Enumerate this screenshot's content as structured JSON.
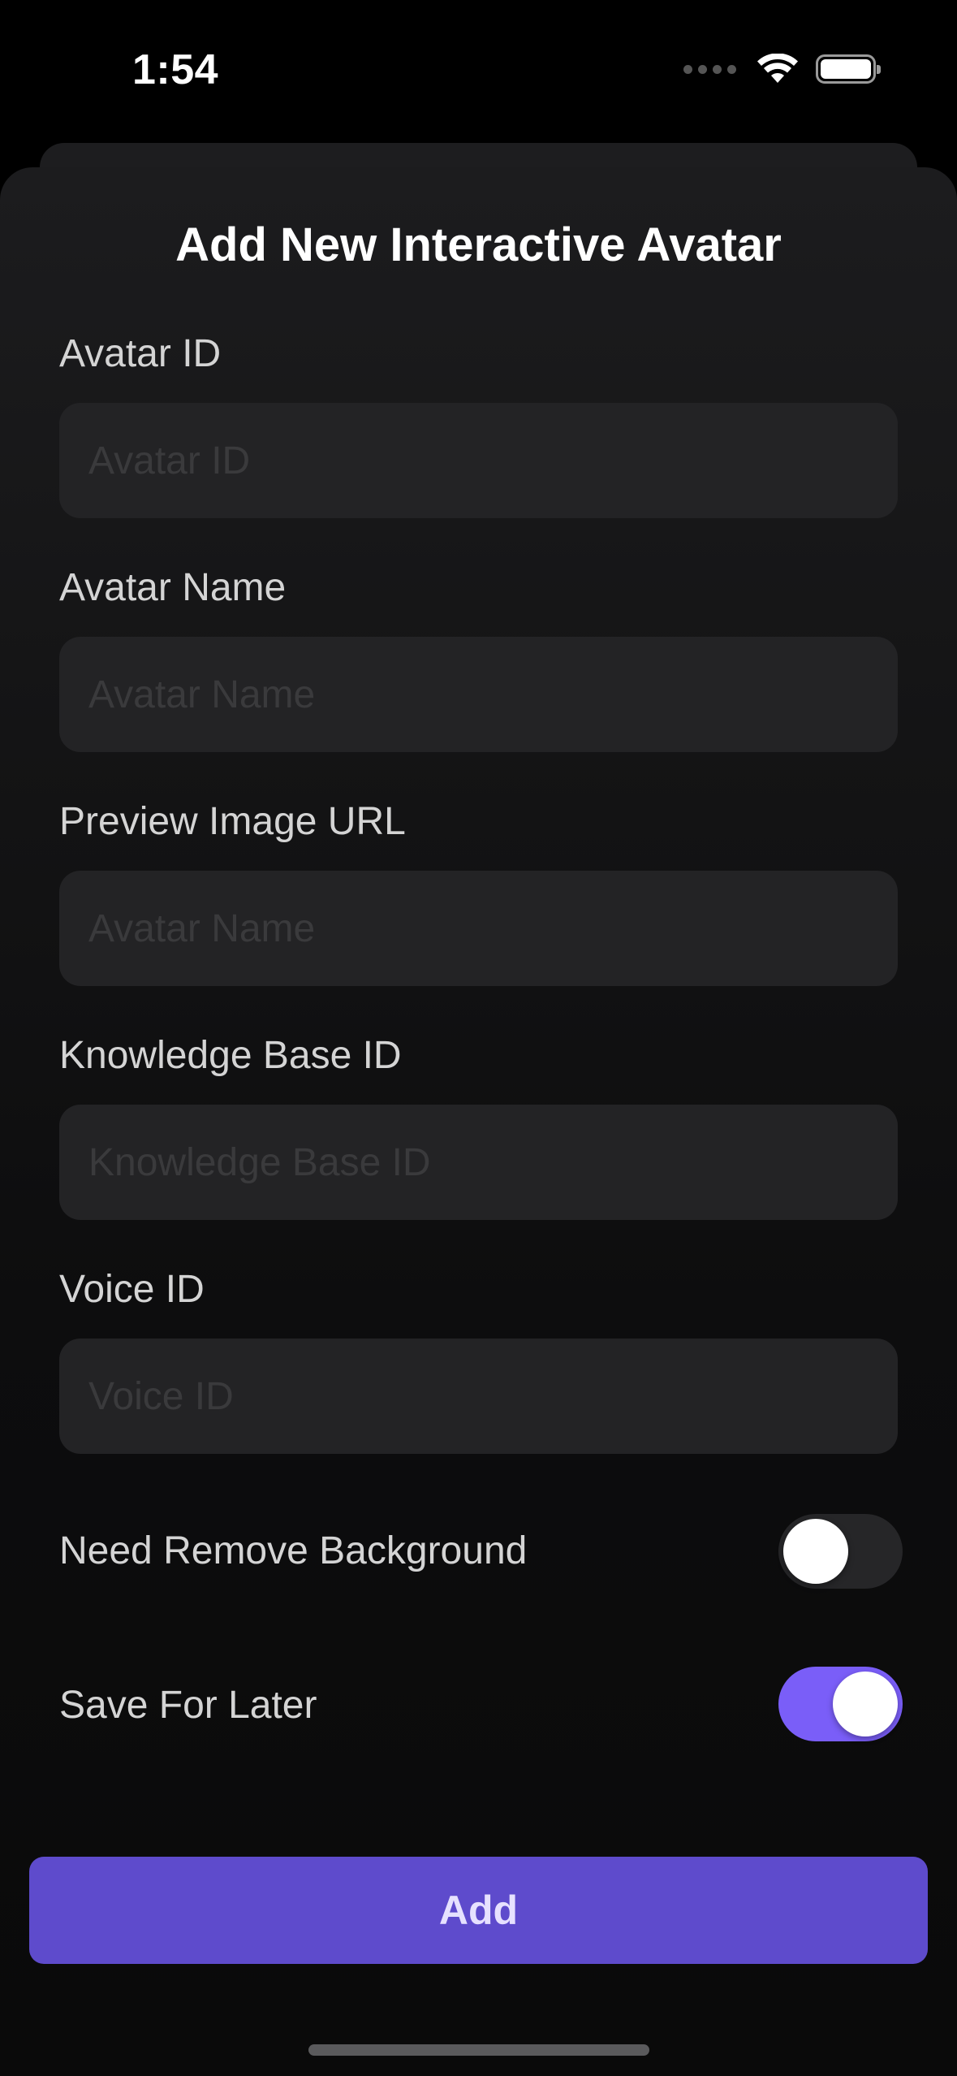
{
  "status_bar": {
    "time": "1:54"
  },
  "sheet": {
    "title": "Add New Interactive Avatar"
  },
  "fields": [
    {
      "label": "Avatar ID",
      "placeholder": "Avatar ID",
      "value": ""
    },
    {
      "label": "Avatar Name",
      "placeholder": "Avatar Name",
      "value": ""
    },
    {
      "label": "Preview Image URL",
      "placeholder": "Avatar Name",
      "value": ""
    },
    {
      "label": "Knowledge Base ID",
      "placeholder": "Knowledge Base ID",
      "value": ""
    },
    {
      "label": "Voice ID",
      "placeholder": "Voice ID",
      "value": ""
    }
  ],
  "toggles": [
    {
      "label": "Need Remove Background",
      "on": false
    },
    {
      "label": "Save For Later",
      "on": true
    }
  ],
  "actions": {
    "add_label": "Add"
  },
  "colors": {
    "accent": "#7a5ef8",
    "button": "#5e4bcc",
    "input_bg": "#232325",
    "background": "#000000"
  }
}
